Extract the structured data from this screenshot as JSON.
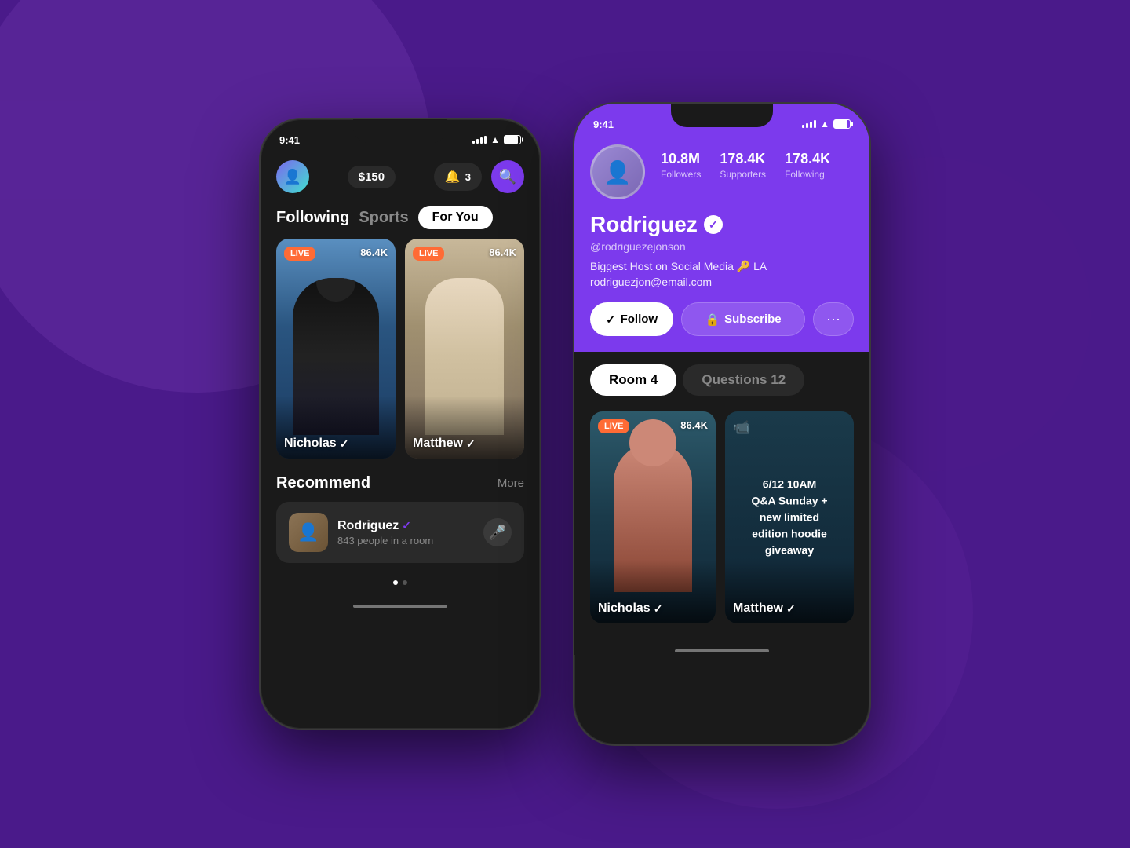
{
  "background": {
    "color": "#4a1a8a"
  },
  "phone1": {
    "status_bar": {
      "time": "9:41",
      "notifications": "3"
    },
    "header": {
      "balance": "$150",
      "notification_count": "3"
    },
    "tabs": {
      "following": "Following",
      "sports": "Sports",
      "for_you": "For You"
    },
    "live_cards": [
      {
        "name": "Nicholas",
        "live_label": "LIVE",
        "viewers": "86.4K",
        "verified": true
      },
      {
        "name": "Matthew",
        "live_label": "LIVE",
        "viewers": "86.4K",
        "verified": true
      }
    ],
    "recommend": {
      "title": "Recommend",
      "more": "More",
      "items": [
        {
          "name": "Rodriguez",
          "subtitle": "843 people in a room",
          "verified": true
        }
      ]
    }
  },
  "phone2": {
    "status_bar": {
      "time": "9:41"
    },
    "profile": {
      "name": "Rodriguez",
      "username": "@rodriguezejonson",
      "bio": "Biggest Host on Social Media 🔑 LA",
      "email": "rodriguezjon@email.com",
      "verified": true,
      "stats": {
        "followers": "10.8M",
        "followers_label": "Followers",
        "supporters": "178.4K",
        "supporters_label": "Supporters",
        "following": "178.4K",
        "following_label": "Following"
      }
    },
    "actions": {
      "follow": "Follow",
      "subscribe": "Subscribe",
      "more": "···"
    },
    "tabs": {
      "room": "Room",
      "room_count": "4",
      "questions": "Questions",
      "questions_count": "12"
    },
    "cards": [
      {
        "name": "Nicholas",
        "live_label": "LIVE",
        "viewers": "86.4K",
        "verified": true
      },
      {
        "name": "Matthew",
        "verified": true,
        "scheduled": "6/12 10AM\nQ&A Sunday +\nnew limited\nedition hoodie\ngiveaway"
      }
    ]
  }
}
